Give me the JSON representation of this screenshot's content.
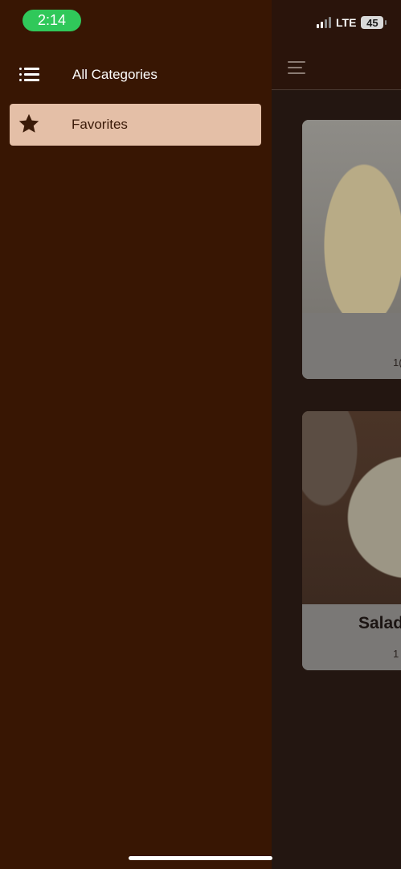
{
  "status_bar": {
    "time": "2:14",
    "network": "LTE",
    "battery": "45"
  },
  "drawer": {
    "header": {
      "label": "All Categories",
      "icon": "list-icon"
    },
    "items": [
      {
        "label": "Favorites",
        "icon": "star-icon",
        "selected": true
      }
    ]
  },
  "background": {
    "cards": [
      {
        "title": "",
        "subtitle": "1("
      },
      {
        "title": "Salad",
        "subtitle": "1"
      }
    ]
  },
  "colors": {
    "drawer_bg": "#381603",
    "selected_item_bg": "#e4bfa7",
    "status_pill": "#30c85a"
  }
}
